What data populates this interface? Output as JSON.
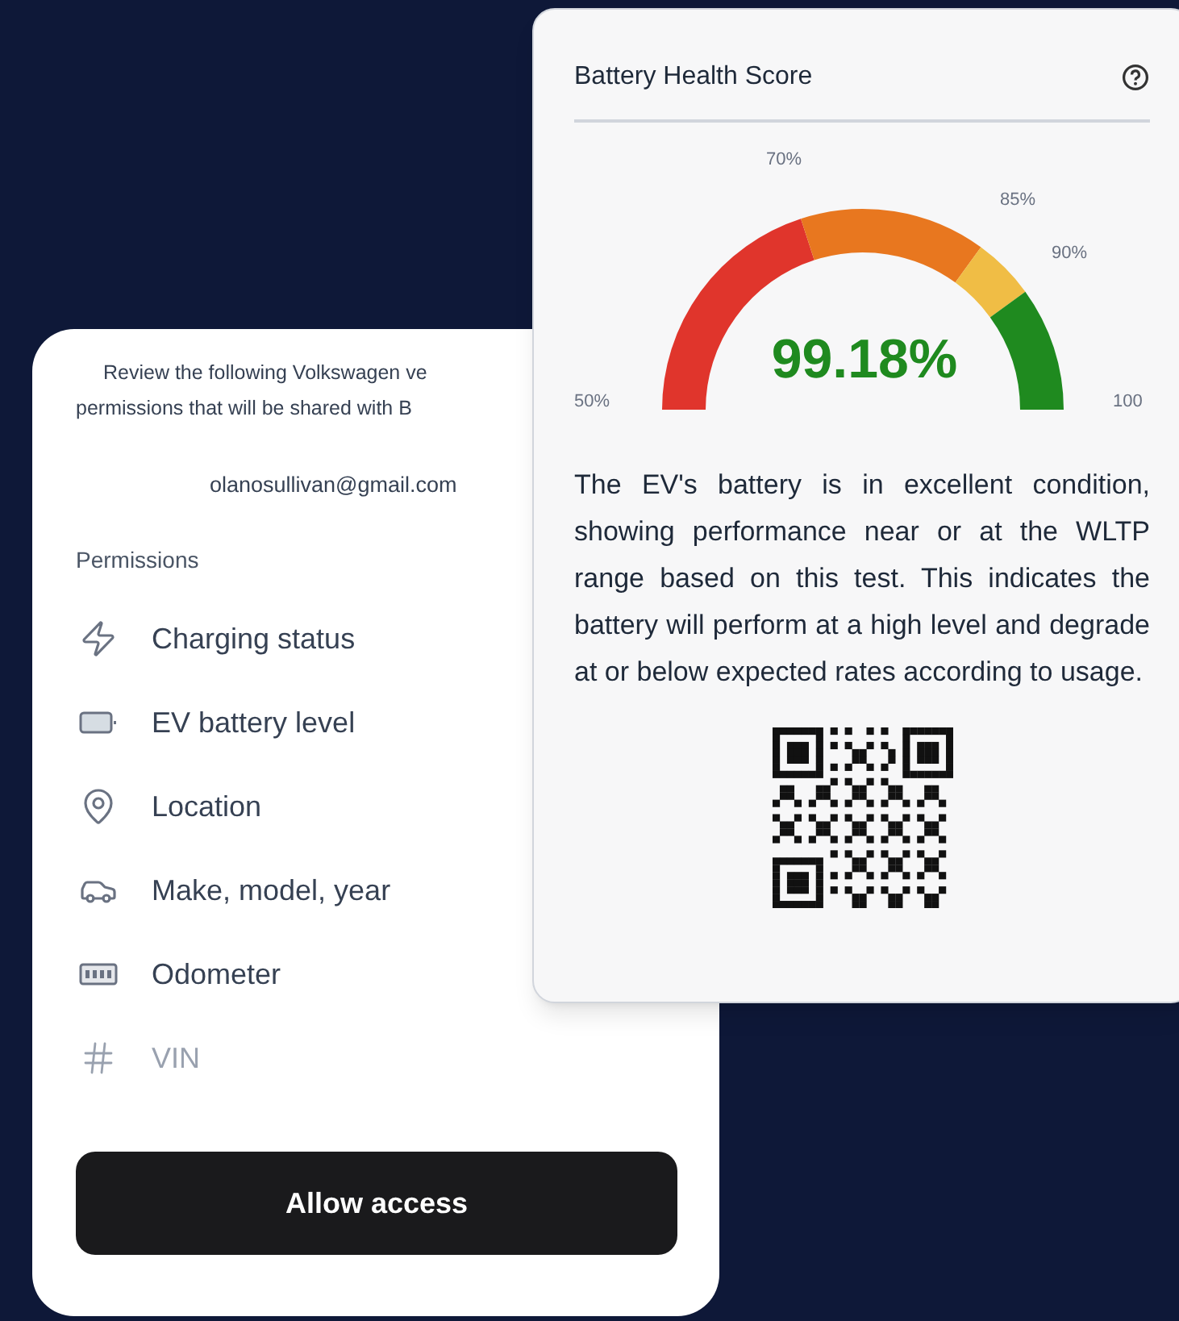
{
  "permissions_card": {
    "intro_lines": [
      "Review the following Volkswagen ve",
      "permissions that will be shared with B"
    ],
    "email": "olanosullivan@gmail.com",
    "section_label": "Permissions",
    "items": [
      {
        "kind": "charging",
        "label": "Charging status",
        "disabled": false
      },
      {
        "kind": "battery",
        "label": "EV battery level",
        "disabled": false
      },
      {
        "kind": "location",
        "label": "Location",
        "disabled": false
      },
      {
        "kind": "car",
        "label": "Make, model, year",
        "disabled": false
      },
      {
        "kind": "odometer",
        "label": "Odometer",
        "disabled": false
      },
      {
        "kind": "vin",
        "label": "VIN",
        "disabled": true
      }
    ],
    "button": "Allow access"
  },
  "health_card": {
    "title": "Battery Health Score",
    "gauge": {
      "score": "99.18%",
      "segments": [
        {
          "color": "#e0352c"
        },
        {
          "color": "#e8771f"
        },
        {
          "color": "#f0bd45"
        },
        {
          "color": "#1f8a1f"
        }
      ],
      "ticks": [
        {
          "label": "50%"
        },
        {
          "label": "70%"
        },
        {
          "label": "85%"
        },
        {
          "label": "90%"
        },
        {
          "label": "100"
        }
      ]
    },
    "description": "The EV's battery is in excellent condition, showing performance near or at the WLTP range based on this test. This indicates the battery will perform at a high level and degrade at or below expected rates according to usage."
  }
}
